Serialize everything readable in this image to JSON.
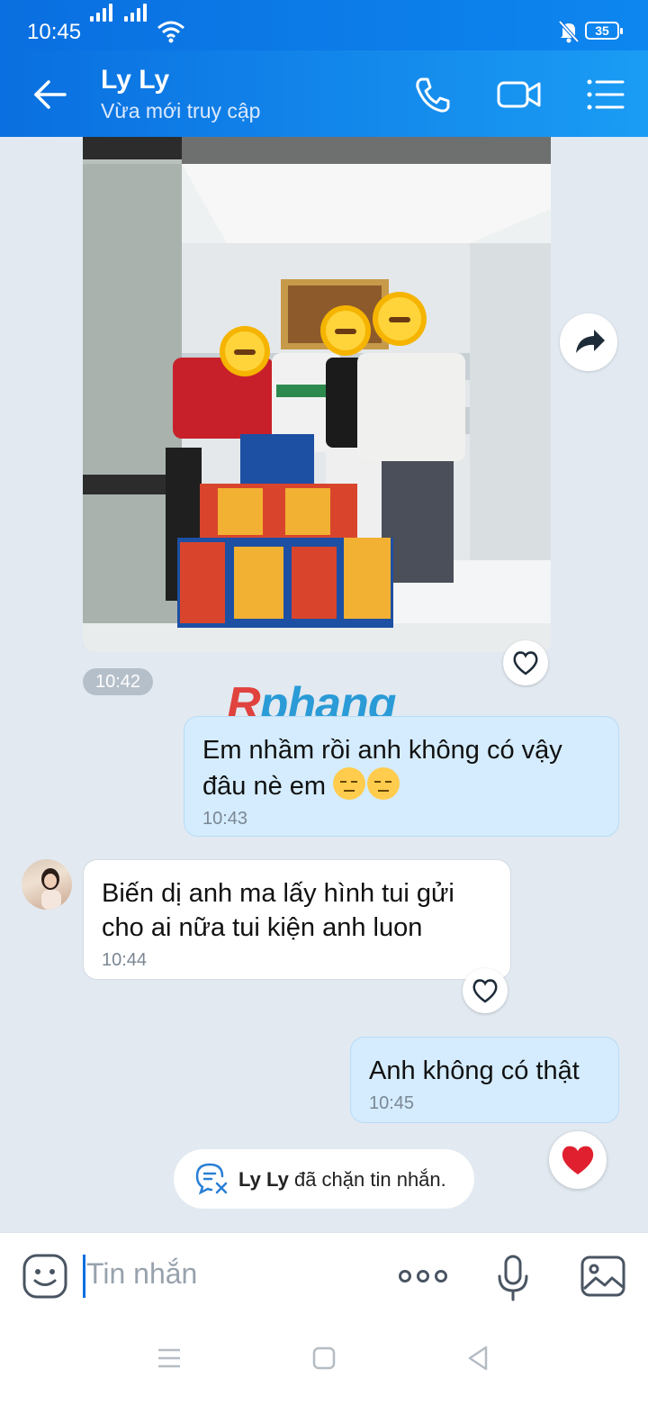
{
  "status_bar": {
    "time": "10:45",
    "battery": "35"
  },
  "header": {
    "contact_name": "Ly Ly",
    "presence": "Vừa mới truy cập"
  },
  "messages": [
    {
      "type": "image",
      "direction": "incoming",
      "time": "10:42"
    },
    {
      "type": "text",
      "direction": "outgoing",
      "text": "Em nhầm rồi anh không có vậy đâu nè em",
      "time": "10:43"
    },
    {
      "type": "text",
      "direction": "incoming",
      "text_line1": "Biến dị anh ma lấy hình tui gửi",
      "text_line2": "cho ai nữa tui kiện anh luon",
      "time": "10:44"
    },
    {
      "type": "text",
      "direction": "outgoing",
      "text": "Anh không có thật",
      "time": "10:45"
    }
  ],
  "watermark": {
    "first_letter": "R",
    "rest": "phang"
  },
  "system_notice": {
    "name": "Ly Ly",
    "text": "đã chặn tin nhắn."
  },
  "composer": {
    "placeholder": "Tin nhắn"
  },
  "colors": {
    "accent": "#0a6fe0",
    "outgoing_bubble": "#d4ecfd",
    "background": "#e2e9f1",
    "heart": "#e0202f"
  },
  "icons": [
    "back-arrow-icon",
    "phone-icon",
    "video-call-icon",
    "menu-list-icon",
    "share-forward-icon",
    "heart-outline-icon",
    "chat-blocked-icon",
    "heart-filled-icon",
    "sticker-emoji-icon",
    "more-dots-icon",
    "microphone-icon",
    "image-gallery-icon"
  ]
}
